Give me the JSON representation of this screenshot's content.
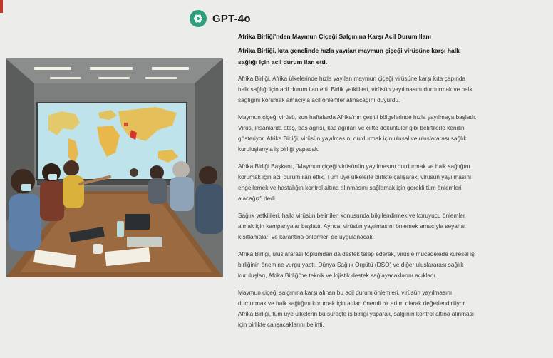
{
  "header": {
    "model_name": "GPT-4o",
    "logo_icon": "openai-logo-icon",
    "accent_color": "#2f9e7c"
  },
  "image": {
    "subject": "conference-room-meeting-illustration"
  },
  "article": {
    "title": "Afrika Birliği'nden Maymun Çiçeği Salgınına Karşı Acil Durum İlanı",
    "lead": "Afrika Birliği, kıta genelinde hızla yayılan maymun çiçeği virüsüne karşı halk sağlığı için acil durum ilan etti.",
    "paragraphs": [
      "Afrika Birliği, Afrika ülkelerinde hızla yayılan maymun çiçeği virüsüne karşı kıta çapında halk sağlığı için acil durum ilan etti. Birlik yetkilileri, virüsün yayılmasını durdurmak ve halk sağlığını korumak amacıyla acil önlemler alınacağını duyurdu.",
      "Maymun çiçeği virüsü, son haftalarda Afrika'nın çeşitli bölgelerinde hızla yayılmaya başladı. Virüs, insanlarda ateş, baş ağrısı, kas ağrıları ve ciltte döküntüler gibi belirtilerle kendini gösteriyor. Afrika Birliği, virüsün yayılmasını durdurmak için ulusal ve uluslararası sağlık kuruluşlarıyla iş birliği yapacak.",
      "Afrika Birliği Başkanı, \"Maymun çiçeği virüsünün yayılmasını durdurmak ve halk sağlığını korumak için acil durum ilan ettik. Tüm üye ülkelerle birlikte çalışarak, virüsün yayılmasını engellemek ve hastalığın kontrol altına alınmasını sağlamak için gerekli tüm önlemleri alacağız\" dedi.",
      "Sağlık yetkilileri, halkı virüsün belirtileri konusunda bilgilendirmek ve koruyucu önlemler almak için kampanyalar başlattı. Ayrıca, virüsün yayılmasını önlemek amacıyla seyahat kısıtlamaları ve karantina önlemleri de uygulanacak.",
      "Afrika Birliği, uluslararası toplumdan da destek talep ederek, virüsle mücadelede küresel iş birliğinin önemine vurgu yaptı. Dünya Sağlık Örgütü (DSÖ) ve diğer uluslararası sağlık kuruluşları, Afrika Birliği'ne teknik ve lojistik destek sağlayacaklarını açıkladı.",
      "Maymun çiçeği salgınına karşı alınan bu acil durum önlemleri, virüsün yayılmasını durdurmak ve halk sağlığını korumak için atılan önemli bir adım olarak değerlendiriliyor. Afrika Birliği, tüm üye ülkelerin bu süreçte iş birliği yaparak, salgının kontrol altına alınması için birlikte çalışacaklarını belirtti."
    ]
  }
}
